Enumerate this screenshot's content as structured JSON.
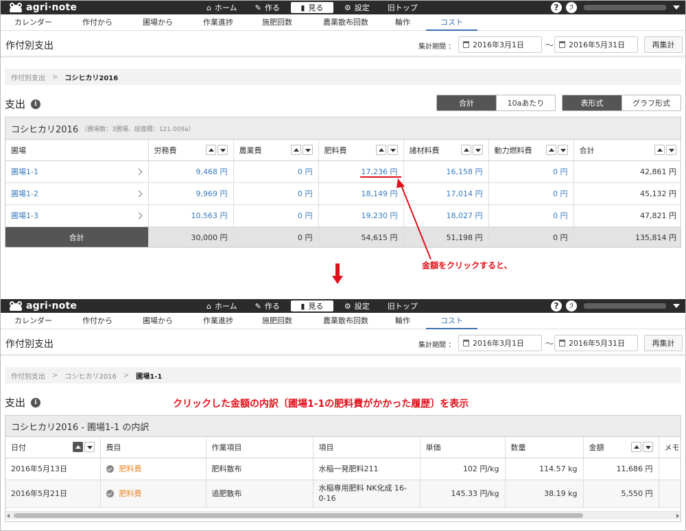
{
  "app": {
    "logo_text": "agri·note"
  },
  "topnav": [
    {
      "icon": "home-icon",
      "glyph": "⌂",
      "label": "ホーム"
    },
    {
      "icon": "pencil-icon",
      "glyph": "✎",
      "label": "作る"
    },
    {
      "icon": "book-icon",
      "glyph": "▮",
      "label": "見る"
    },
    {
      "icon": "gear-icon",
      "glyph": "⚙",
      "label": "設定"
    },
    {
      "icon": "",
      "glyph": "",
      "label": "旧トップ"
    }
  ],
  "help_glyph": "?",
  "subtabs": [
    "カレンダー",
    "作付から",
    "圃場から",
    "作業進捗",
    "施肥回数",
    "農薬散布回数",
    "輪作",
    "コスト"
  ],
  "page_title": "作付別支出",
  "period": {
    "label": "集計期間 ：",
    "start": "2016年3月1日",
    "end": "2016年5月31日",
    "separator": "〜",
    "recalc": "再集計"
  },
  "top": {
    "breadcrumb": [
      "作付別支出",
      "コシヒカリ2016"
    ],
    "breadcrumb_sep": ">",
    "section_title": "支出",
    "toggle_mode": [
      "合計",
      "10aあたり"
    ],
    "toggle_view": [
      "表形式",
      "グラフ形式"
    ],
    "panel_title": "コシヒカリ2016",
    "panel_sub": "（圃場数：3圃場、総面積：121.009a）",
    "columns": [
      "圃場",
      "労務費",
      "農業費",
      "肥料費",
      "諸材料費",
      "動力燃料費",
      "合計"
    ],
    "rows": [
      {
        "field": "圃場1-1",
        "values": [
          "9,468 円",
          "0 円",
          "17,236 円",
          "16,158 円",
          "0 円",
          "42,861 円"
        ]
      },
      {
        "field": "圃場1-2",
        "values": [
          "9,969 円",
          "0 円",
          "18,149 円",
          "17,014 円",
          "0 円",
          "45,132 円"
        ]
      },
      {
        "field": "圃場1-3",
        "values": [
          "10,563 円",
          "0 円",
          "19,230 円",
          "18,027 円",
          "0 円",
          "47,821 円"
        ]
      }
    ],
    "total": {
      "label": "合計",
      "values": [
        "30,000 円",
        "0 円",
        "54,615 円",
        "51,198 円",
        "0 円",
        "135,814 円"
      ]
    }
  },
  "annotation_click": "金額をクリックすると、",
  "annotation_show": "クリックした金額の内訳〔圃場1-1の肥料費がかかった履歴〕を表示",
  "bottom": {
    "breadcrumb": [
      "作付別支出",
      "コシヒカリ2016",
      "圃場1-1"
    ],
    "breadcrumb_sep": ">",
    "section_title": "支出",
    "panel_title": "コシヒカリ2016 - 圃場1-1 の内訳",
    "columns": [
      "日付",
      "費目",
      "作業項目",
      "項目",
      "単価",
      "数量",
      "金額",
      "メモ"
    ],
    "rows": [
      {
        "date": "2016年5月13日",
        "cost_type": "肥料費",
        "work": "肥料散布",
        "item": "水稲一発肥料211",
        "unit_price": "102 円/kg",
        "quantity": "114.57 kg",
        "amount": "11,686 円"
      },
      {
        "date": "2016年5月21日",
        "cost_type": "肥料費",
        "work": "追肥散布",
        "item": "水稲専用肥料 NK化成 16-0-16",
        "unit_price": "145.33 円/kg",
        "quantity": "38.19 kg",
        "amount": "5,550 円"
      }
    ]
  },
  "colors": {
    "accent": "#3a6fb0",
    "annotation": "#e0101a",
    "cost_type": "#e58a2c",
    "dark": "#2b2b2b"
  }
}
